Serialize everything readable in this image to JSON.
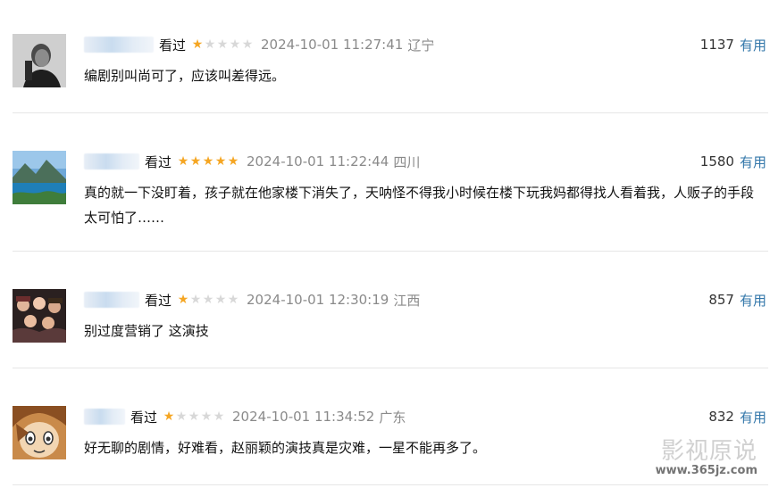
{
  "reviews": [
    {
      "username_visible": "",
      "status": "看过",
      "rating": 1,
      "time": "2024-10-01 11:27:41",
      "location": "辽宁",
      "votes": "1137",
      "useful_label": "有用",
      "content": "编剧别叫尚可了，应该叫差得远。"
    },
    {
      "username_visible": "",
      "status": "看过",
      "rating": 5,
      "time": "2024-10-01 11:22:44",
      "location": "四川",
      "votes": "1580",
      "useful_label": "有用",
      "content": "真的就一下没盯着，孩子就在他家楼下消失了，天呐怪不得我小时候在楼下玩我妈都得找人看着我，人贩子的手段太可怕了……"
    },
    {
      "username_visible": "",
      "status": "看过",
      "rating": 1,
      "time": "2024-10-01 12:30:19",
      "location": "江西",
      "votes": "857",
      "useful_label": "有用",
      "content": "别过度营销了 这演技"
    },
    {
      "username_visible": "",
      "status": "看过",
      "rating": 1,
      "time": "2024-10-01 11:34:52",
      "location": "广东",
      "votes": "832",
      "useful_label": "有用",
      "content": "好无聊的剧情，好难看，赵丽颖的演技真是灾难，一星不能再多了。"
    }
  ],
  "watermark": {
    "title": "影视原说",
    "url": "www.365jz.com"
  },
  "colors": {
    "star_on": "#f5a623",
    "star_off": "#d8d8d8",
    "link": "#3377aa",
    "muted": "#8a8a8a"
  }
}
